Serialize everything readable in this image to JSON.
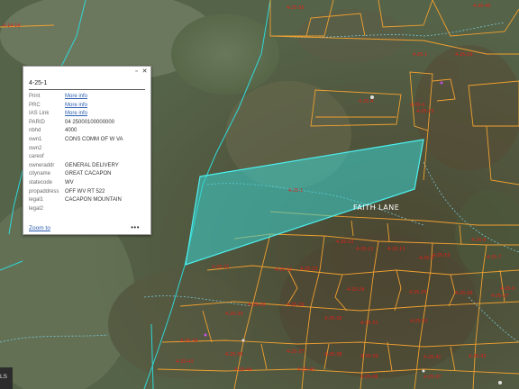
{
  "popup": {
    "title": "4-25-1",
    "fields": [
      {
        "name": "Print",
        "value": "More info",
        "link": true
      },
      {
        "name": "PRC",
        "value": "More info",
        "link": true
      },
      {
        "name": "IAS Link",
        "value": "More info",
        "link": true
      },
      {
        "name": "PARID",
        "value": "04 25000100000000",
        "link": false
      },
      {
        "name": "nbhd",
        "value": "4000",
        "link": false
      },
      {
        "name": "own1",
        "value": "CONS COMM OF W VA",
        "link": false
      },
      {
        "name": "own2",
        "value": "",
        "link": false
      },
      {
        "name": "careof",
        "value": "",
        "link": false
      },
      {
        "name": "owneraddr",
        "value": "GENERAL DELIVERY",
        "link": false
      },
      {
        "name": "cityname",
        "value": "GREAT CACAPON",
        "link": false
      },
      {
        "name": "statecode",
        "value": "WV",
        "link": false
      },
      {
        "name": "propaddress",
        "value": "OFF WV RT 522",
        "link": false
      },
      {
        "name": "legal1",
        "value": "CACAPON MOUNTAIN",
        "link": false
      },
      {
        "name": "legal2",
        "value": "",
        "link": false
      }
    ],
    "zoom_label": "Zoom to",
    "more_label": "•••",
    "minimize_icon": "minimize-icon",
    "close_icon": "close-icon"
  },
  "map": {
    "road_label": "FAITH LANE",
    "parcel_color": "#f0a030",
    "selected_fill": "#3ad4d0",
    "selected_outline": "#4df0f0",
    "boundary_color": "#2fd8d8",
    "stream_color": "#7fd3e8",
    "label_color": "#e0201a",
    "parcel_labels": [
      "4-25-1",
      "4-25-35",
      "4-14-16",
      "4-25-40",
      "4-25-1",
      "4-25-4",
      "4-25-4",
      "4-25-19",
      "4-25-15",
      "4-25-3",
      "4-25-13",
      "4-25-12",
      "4-25-11",
      "4-25-10",
      "4-25-7",
      "4-25-8",
      "4-25-9",
      "4-25-21",
      "4-25-22",
      "4-25-23",
      "4-25-24",
      "4-25-25",
      "4-25-26",
      "4-25-27",
      "4-25-28",
      "4-25-29",
      "4-25-30",
      "4-25-31",
      "4-25-32",
      "4-25-33",
      "4-25-34",
      "4-25-36",
      "4-25-37",
      "4-25-38",
      "4-25-39",
      "4-25-41",
      "4-25-42",
      "4-25-43",
      "4-25-44",
      "4-25-45",
      "4-25-46",
      "4-25-47"
    ]
  },
  "corner": {
    "label": "LS"
  }
}
